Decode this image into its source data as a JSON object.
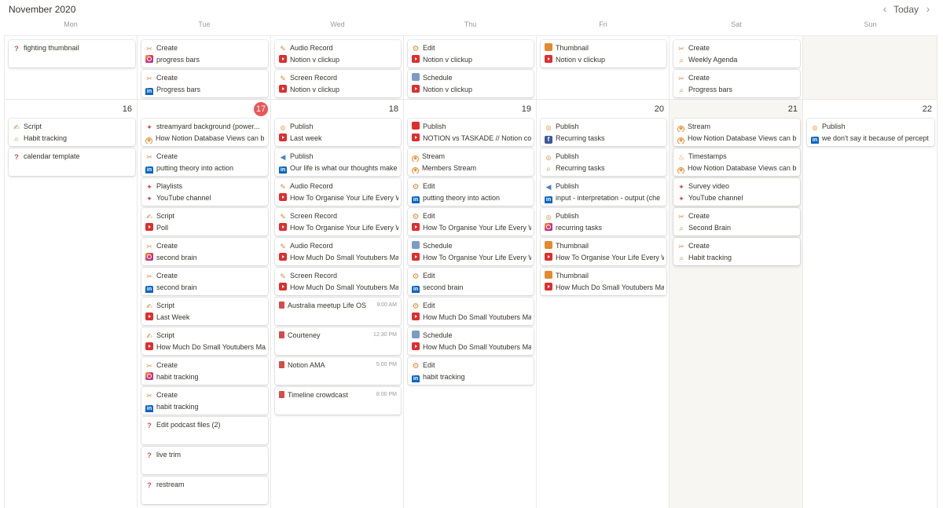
{
  "header": {
    "month": "November 2020",
    "today_label": "Today",
    "prev_icon": "‹",
    "next_icon": "›"
  },
  "weekdays": [
    "Mon",
    "Tue",
    "Wed",
    "Thu",
    "Fri",
    "Sat",
    "Sun"
  ],
  "weeks": [
    {
      "days": [
        {
          "number": "",
          "weekend": false,
          "today": false,
          "cards": [
            {
              "icon1": "question",
              "text1": "fighting thumbnail"
            }
          ]
        },
        {
          "number": "",
          "weekend": false,
          "today": false,
          "cards": [
            {
              "icon1": "tools",
              "text1": "Create",
              "icon2": "instagram",
              "text2": "progress bars"
            },
            {
              "icon1": "tools",
              "text1": "Create",
              "icon2": "linkedin",
              "text2": "Progress bars"
            }
          ]
        },
        {
          "number": "",
          "weekend": false,
          "today": false,
          "cards": [
            {
              "icon1": "mic",
              "text1": "Audio Record",
              "icon2": "youtube",
              "text2": "Notion v clickup"
            },
            {
              "icon1": "screen",
              "text1": "Screen Record",
              "icon2": "youtube",
              "text2": "Notion v clickup"
            }
          ]
        },
        {
          "number": "",
          "weekend": false,
          "today": false,
          "cards": [
            {
              "icon1": "gear",
              "text1": "Edit",
              "icon2": "youtube",
              "text2": "Notion v clickup"
            },
            {
              "icon1": "calendar",
              "text1": "Schedule",
              "icon2": "youtube",
              "text2": "Notion v clickup"
            }
          ]
        },
        {
          "number": "",
          "weekend": false,
          "today": false,
          "cards": [
            {
              "icon1": "image",
              "text1": "Thumbnail",
              "icon2": "youtube",
              "text2": "Notion v clickup"
            }
          ]
        },
        {
          "number": "",
          "weekend": false,
          "today": false,
          "cards": [
            {
              "icon1": "tools",
              "text1": "Create",
              "icon2": "search",
              "text2": "Weekly Agenda"
            },
            {
              "icon1": "tools",
              "text1": "Create",
              "icon2": "search",
              "text2": "Progress bars"
            }
          ]
        },
        {
          "number": "",
          "weekend": true,
          "today": false,
          "cards": []
        }
      ]
    },
    {
      "days": [
        {
          "number": "16",
          "weekend": false,
          "today": false,
          "cards": [
            {
              "icon1": "pen",
              "text1": "Script",
              "icon2": "search",
              "text2": "Habit tracking"
            },
            {
              "icon1": "question",
              "text1": "calendar template"
            }
          ]
        },
        {
          "number": "17",
          "weekend": false,
          "today": true,
          "cards": [
            {
              "icon1": "pin",
              "text1": "streamyard background (power...",
              "icon2": "stream",
              "text2": "How Notion Database Views can b"
            },
            {
              "icon1": "tools",
              "text1": "Create",
              "icon2": "linkedin",
              "text2": "putting theory into action"
            },
            {
              "icon1": "pin",
              "text1": "Playlists",
              "icon2": "pin",
              "text2": "YouTube channel"
            },
            {
              "icon1": "pen",
              "text1": "Script",
              "icon2": "youtube",
              "text2": "Poll"
            },
            {
              "icon1": "tools",
              "text1": "Create",
              "icon2": "instagram",
              "text2": "second brain"
            },
            {
              "icon1": "tools",
              "text1": "Create",
              "icon2": "linkedin",
              "text2": "second brain"
            },
            {
              "icon1": "pen",
              "text1": "Script",
              "icon2": "youtube",
              "text2": "Last Week"
            },
            {
              "icon1": "pen",
              "text1": "Script",
              "icon2": "youtube",
              "text2": "How Much Do Small Youtubers Ma"
            },
            {
              "icon1": "tools",
              "text1": "Create",
              "icon2": "instagram",
              "text2": "habit tracking"
            },
            {
              "icon1": "tools",
              "text1": "Create",
              "icon2": "linkedin",
              "text2": "habit tracking"
            },
            {
              "icon1": "question",
              "text1": "Edit podcast files (2)"
            },
            {
              "icon1": "question",
              "text1": "live trim"
            },
            {
              "icon1": "question",
              "text1": "restream"
            }
          ]
        },
        {
          "number": "18",
          "weekend": false,
          "today": false,
          "cards": [
            {
              "icon1": "broadcast",
              "text1": "Publish",
              "icon2": "youtube",
              "text2": "Last week"
            },
            {
              "icon1": "megaphone",
              "text1": "Publish",
              "icon2": "linkedin",
              "text2": "Our life is what our thoughts make"
            },
            {
              "icon1": "mic",
              "text1": "Audio Record",
              "icon2": "youtube",
              "text2": "How To Organise Your Life Every W"
            },
            {
              "icon1": "screen",
              "text1": "Screen Record",
              "icon2": "youtube",
              "text2": "How To Organise Your Life Every W"
            },
            {
              "icon1": "mic",
              "text1": "Audio Record",
              "icon2": "youtube",
              "text2": "How Much Do Small Youtubers Ma"
            },
            {
              "icon1": "screen",
              "text1": "Screen Record",
              "icon2": "youtube",
              "text2": "How Much Do Small Youtubers Ma"
            },
            {
              "icon1": "book",
              "text1": "Australia meetup Life OS",
              "time": "9:00 AM"
            },
            {
              "icon1": "book",
              "text1": "Courteney",
              "time": "12:30 PM"
            },
            {
              "icon1": "book",
              "text1": "Notion AMA",
              "time": "5:00 PM"
            },
            {
              "icon1": "book",
              "text1": "Timeline crowdcast",
              "time": "8:00 PM"
            }
          ]
        },
        {
          "number": "19",
          "weekend": false,
          "today": false,
          "cards": [
            {
              "icon1": "label",
              "text1": "Publish",
              "icon2": "youtube",
              "text2": "NOTION vs TASKADE // Notion co"
            },
            {
              "icon1": "stream",
              "text1": "Stream",
              "icon2": "stream",
              "text2": "Members Stream"
            },
            {
              "icon1": "gear",
              "text1": "Edit",
              "icon2": "linkedin",
              "text2": "putting theory into action"
            },
            {
              "icon1": "gear",
              "text1": "Edit",
              "icon2": "youtube",
              "text2": "How To Organise Your Life Every W"
            },
            {
              "icon1": "calendar",
              "text1": "Schedule",
              "icon2": "youtube",
              "text2": "How To Organise Your Life Every W"
            },
            {
              "icon1": "gear",
              "text1": "Edit",
              "icon2": "linkedin",
              "text2": "second brain"
            },
            {
              "icon1": "gear",
              "text1": "Edit",
              "icon2": "youtube",
              "text2": "How Much Do Small Youtubers Ma"
            },
            {
              "icon1": "calendar",
              "text1": "Schedule",
              "icon2": "youtube",
              "text2": "How Much Do Small Youtubers Ma"
            },
            {
              "icon1": "gear",
              "text1": "Edit",
              "icon2": "linkedin",
              "text2": "habit tracking"
            }
          ]
        },
        {
          "number": "20",
          "weekend": false,
          "today": false,
          "cards": [
            {
              "icon1": "broadcast",
              "text1": "Publish",
              "icon2": "facebook",
              "text2": "Recurring tasks"
            },
            {
              "icon1": "broadcast",
              "text1": "Publish",
              "icon2": "search",
              "text2": "Recurring tasks"
            },
            {
              "icon1": "megaphone",
              "text1": "Publish",
              "icon2": "linkedin",
              "text2": "input - interpretation - output (che"
            },
            {
              "icon1": "broadcast",
              "text1": "Publish",
              "icon2": "instagram",
              "text2": "recurring tasks"
            },
            {
              "icon1": "image",
              "text1": "Thumbnail",
              "icon2": "youtube",
              "text2": "How To Organise Your Life Every W"
            },
            {
              "icon1": "image",
              "text1": "Thumbnail",
              "icon2": "youtube",
              "text2": "How Much Do Small Youtubers Ma"
            }
          ]
        },
        {
          "number": "21",
          "weekend": true,
          "today": false,
          "cards": [
            {
              "icon1": "stream",
              "text1": "Stream",
              "icon2": "stream",
              "text2": "How Notion Database Views can b"
            },
            {
              "icon1": "fire",
              "text1": "Timestamps",
              "icon2": "stream",
              "text2": "How Notion Database Views can b"
            },
            {
              "icon1": "pin",
              "text1": "Survey video",
              "icon2": "pin",
              "text2": "YouTube channel"
            },
            {
              "icon1": "tools",
              "text1": "Create",
              "icon2": "search",
              "text2": "Second Brain"
            },
            {
              "icon1": "tools",
              "text1": "Create",
              "icon2": "search",
              "text2": "Habit tracking"
            }
          ]
        },
        {
          "number": "22",
          "weekend": false,
          "today": false,
          "cards": [
            {
              "icon1": "broadcast",
              "text1": "Publish",
              "icon2": "linkedin",
              "text2": "we don't say it because of percept"
            }
          ]
        }
      ]
    }
  ],
  "icons": {
    "question": "?",
    "tools": "✂",
    "mic": "✎",
    "screen": "✎",
    "gear": "⚙",
    "pen": "✍",
    "pin": "📌",
    "broadcast": "((•))",
    "megaphone": "📢",
    "fire": "♨",
    "search": "⌕",
    "stream": "◉",
    "linkedin": "in",
    "facebook": "f"
  },
  "colors": {
    "today": "#eb5757",
    "weekend_bg": "#f7f6f3",
    "youtube": "#e02d2d",
    "linkedin": "#0a66c2"
  }
}
